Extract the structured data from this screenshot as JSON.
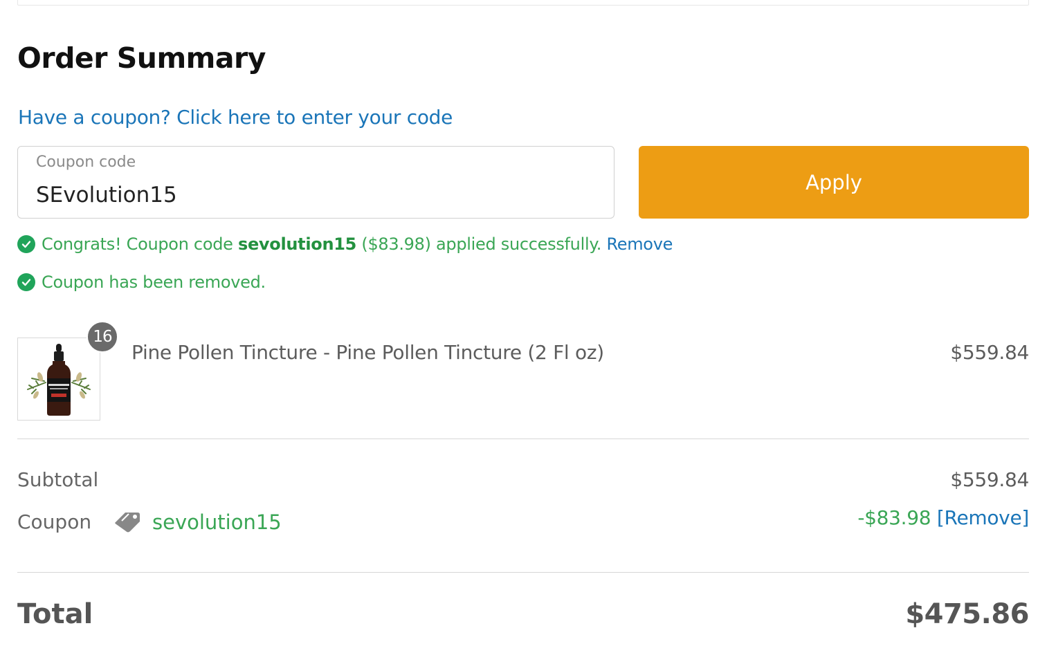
{
  "order_summary": {
    "title": "Order Summary",
    "coupon_prompt": "Have a coupon? Click here to enter your code",
    "coupon_input": {
      "label": "Coupon code",
      "value": "SEvolution15"
    },
    "apply_label": "Apply",
    "notices": {
      "applied": {
        "prefix": "Congrats! Coupon code ",
        "code": "sevolution15",
        "suffix": " ($83.98) applied successfully. ",
        "remove_label": "Remove"
      },
      "removed": {
        "text": "Coupon has been removed."
      }
    },
    "item": {
      "quantity": "16",
      "name": "Pine Pollen Tincture - Pine Pollen Tincture (2 Fl oz)",
      "price": "$559.84"
    },
    "totals": {
      "subtotal_label": "Subtotal",
      "subtotal_value": "$559.84",
      "coupon_label": "Coupon",
      "coupon_code": "sevolution15",
      "discount": "-$83.98",
      "remove_label": "[Remove]",
      "total_label": "Total",
      "total_value": "$475.86"
    }
  },
  "icons": {
    "check": "check-circle-icon",
    "tag": "tag-icon"
  },
  "colors": {
    "accent_orange": "#ed9d14",
    "link_blue": "#1a75b8",
    "success_green": "#3aa655"
  }
}
